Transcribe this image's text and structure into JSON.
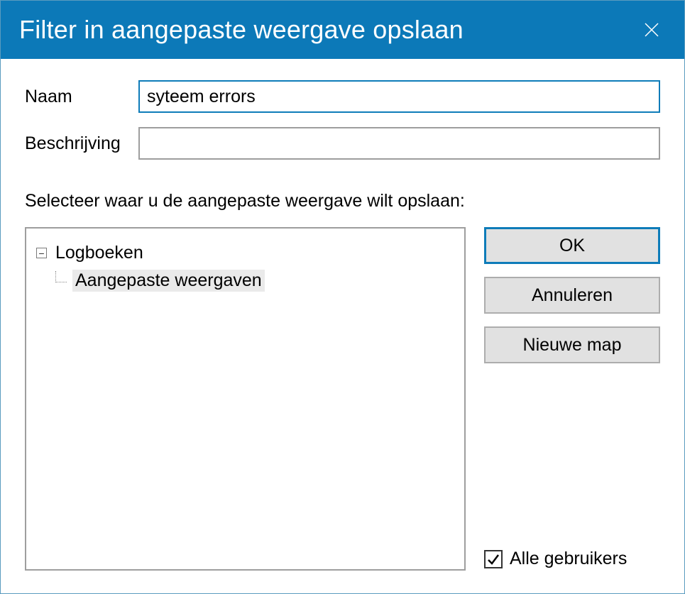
{
  "titlebar": {
    "title": "Filter in aangepaste weergave opslaan"
  },
  "form": {
    "name_label": "Naam",
    "name_value": "syteem errors",
    "description_label": "Beschrijving",
    "description_value": ""
  },
  "instruction": "Selecteer waar u de aangepaste weergave wilt opslaan:",
  "tree": {
    "root": {
      "label": "Logboeken",
      "expanded": true,
      "children": [
        {
          "label": "Aangepaste weergaven",
          "selected": true
        }
      ]
    }
  },
  "buttons": {
    "ok": "OK",
    "cancel": "Annuleren",
    "new_folder": "Nieuwe map"
  },
  "checkbox": {
    "all_users_label": "Alle gebruikers",
    "all_users_checked": true
  }
}
